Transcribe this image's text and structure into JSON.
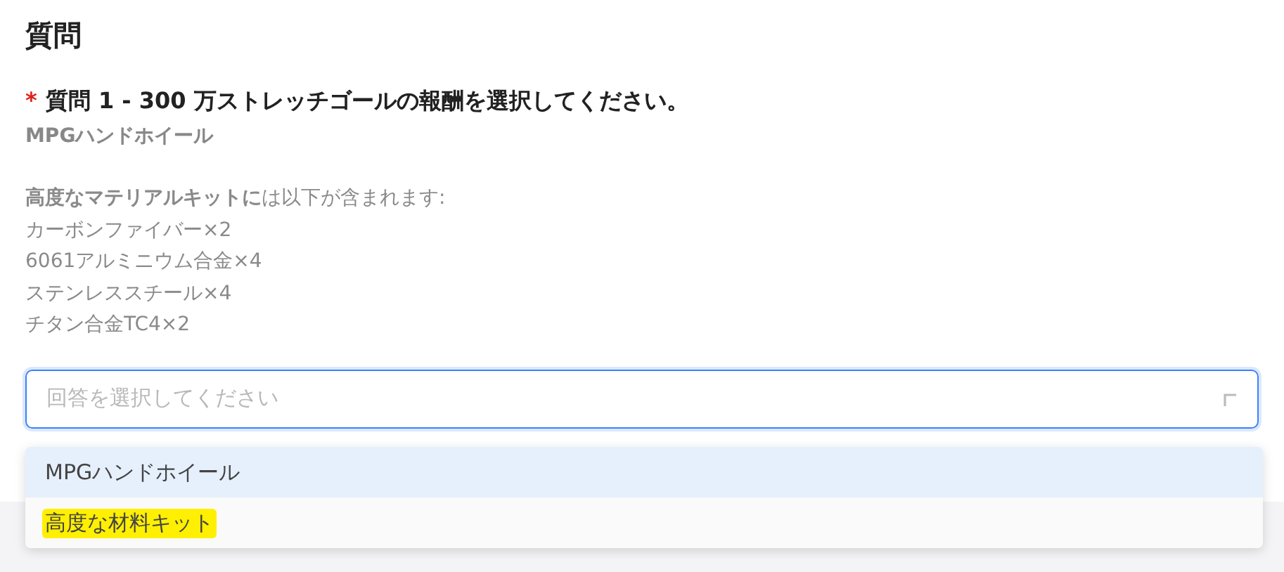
{
  "section_title": "質問",
  "question": {
    "required_mark": "*",
    "label": "質問 1 - 300 万ストレッチゴールの報酬を選択してください。",
    "subtitle": "MPGハンドホイール",
    "description": [
      "**高度なマテリアルキットに**は以下が含まれます:",
      "カーボンファイバー×2",
      "6061アルミニウム合金×4",
      "ステンレススチール×4",
      "チタン合金TC4×2"
    ]
  },
  "select": {
    "placeholder": "回答を選択してください",
    "expanded": true,
    "options": [
      {
        "label": "MPGハンドホイール",
        "selected": true,
        "highlighted": false
      },
      {
        "label": "高度な材料キット",
        "selected": false,
        "highlighted": true
      }
    ]
  }
}
